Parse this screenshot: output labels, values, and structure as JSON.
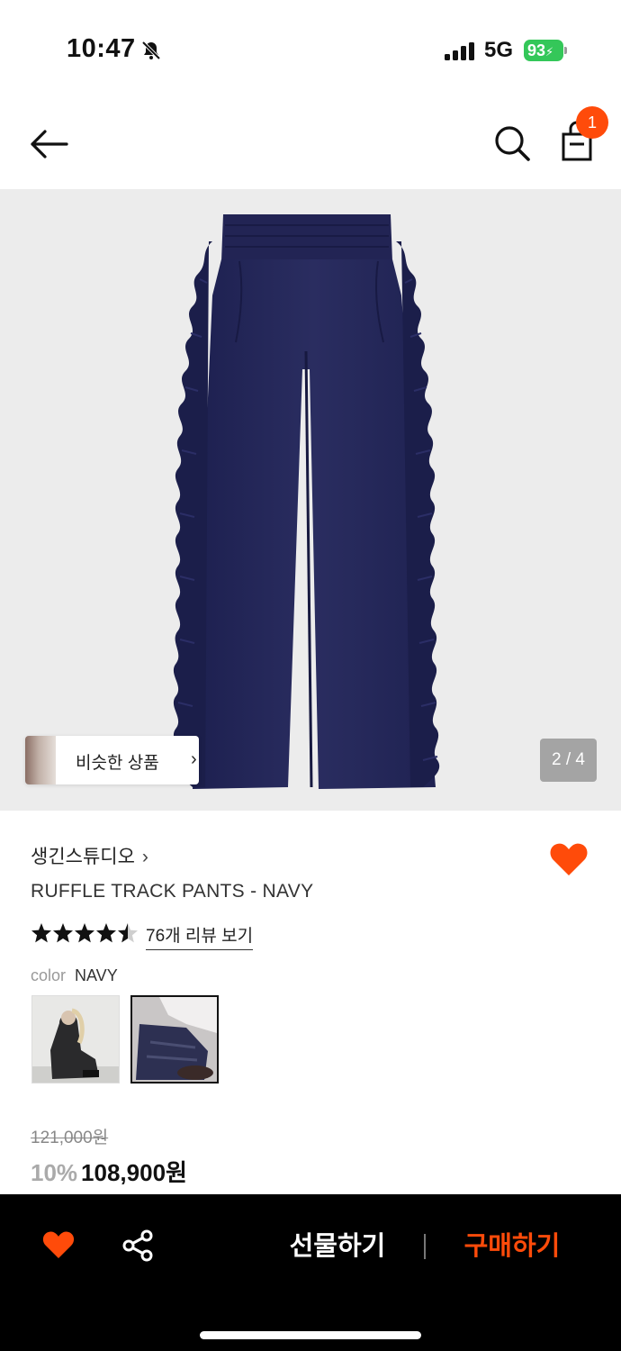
{
  "status_bar": {
    "time": "10:47",
    "network": "5G",
    "battery": "93",
    "icons": [
      "bell-slash-icon",
      "cellular-signal-icon",
      "battery-charging-icon"
    ]
  },
  "header": {
    "icons": [
      "back-arrow-icon",
      "search-icon",
      "shopping-bag-icon"
    ],
    "cart_count": "1"
  },
  "gallery": {
    "similar_label": "비슷한 상품",
    "similar_chevron": "›",
    "page_indicator": "2 / 4"
  },
  "product": {
    "brand": "생긴스튜디오",
    "brand_chevron": "›",
    "title": "RUFFLE TRACK PANTS - NAVY",
    "rating": 4.5,
    "review_link": "76개 리뷰 보기",
    "option_label": "color",
    "option_value": "NAVY",
    "favorited": true,
    "price": {
      "original": "121,000원",
      "discount": "10%",
      "final": "108,900원"
    }
  },
  "bottom_bar": {
    "gift_label": "선물하기",
    "buy_label": "구매하기"
  },
  "colors": {
    "accent": "#ff4b0a",
    "battery": "#34c759",
    "product_navy": "#26295a"
  }
}
